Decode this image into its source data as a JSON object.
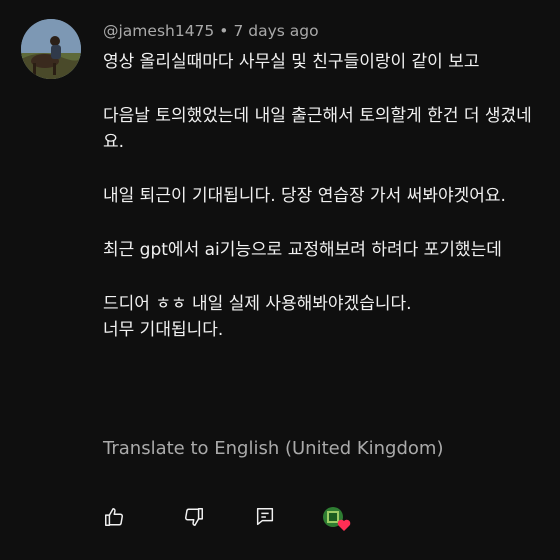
{
  "comment": {
    "author": "@jamesh1475",
    "separator": "•",
    "timestamp": "7 days ago",
    "paragraphs": [
      "영상 올리실때마다 사무실 및 친구들이랑이 같이 보고",
      "다음날 토의했었는데 내일 출근해서 토의할게 한건 더 생겼네요.",
      "내일 퇴근이 기대됩니다. 당장 연습장 가서 써봐야겟어요.",
      "최근 gpt에서 ai기능으로 교정해보려 하려다 포기했는데",
      "드디어 ㅎㅎ 내일 실제 사용해봐야겠습니다.\n너무 기대됩니다."
    ],
    "translate_label": "Translate to English (United Kingdom)"
  },
  "actions": {
    "like_icon": "thumbs-up-icon",
    "dislike_icon": "thumbs-down-icon",
    "reply_icon": "reply-icon",
    "creator_heart_icon": "creator-heart-icon"
  },
  "colors": {
    "background": "#0f0f0f",
    "text": "#f1f1f1",
    "secondary_text": "#aaaaaa",
    "heart": "#ff2e55"
  }
}
